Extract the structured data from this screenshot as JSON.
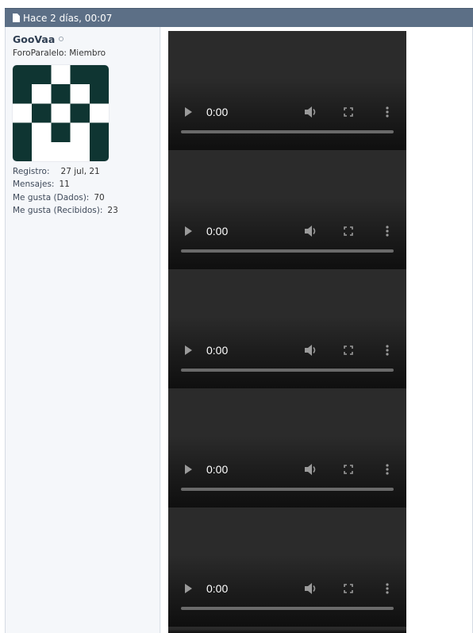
{
  "post": {
    "timestamp": "Hace 2 días, 00:07"
  },
  "user": {
    "username": "GooVaa",
    "title": "ForoParalelo: Miembro",
    "stats": [
      {
        "label": "Registro:",
        "value": "27 jul, 21"
      },
      {
        "label": "Mensajes:",
        "value": "11"
      },
      {
        "label": "Me gusta (Dados):",
        "value": "70"
      },
      {
        "label": "Me gusta (Recibidos):",
        "value": "23"
      }
    ]
  },
  "videos": [
    {
      "time": "0:00"
    },
    {
      "time": "0:00"
    },
    {
      "time": "0:00"
    },
    {
      "time": "0:00"
    },
    {
      "time": "0:00"
    }
  ],
  "icons": {
    "post": "document-icon",
    "status": "offline-dot-icon",
    "play": "play-icon",
    "volume": "volume-icon",
    "fullscreen": "fullscreen-icon",
    "more": "more-vertical-icon"
  },
  "colors": {
    "header_bg": "#5c6f86",
    "avatar_fill": "#0f3532"
  }
}
